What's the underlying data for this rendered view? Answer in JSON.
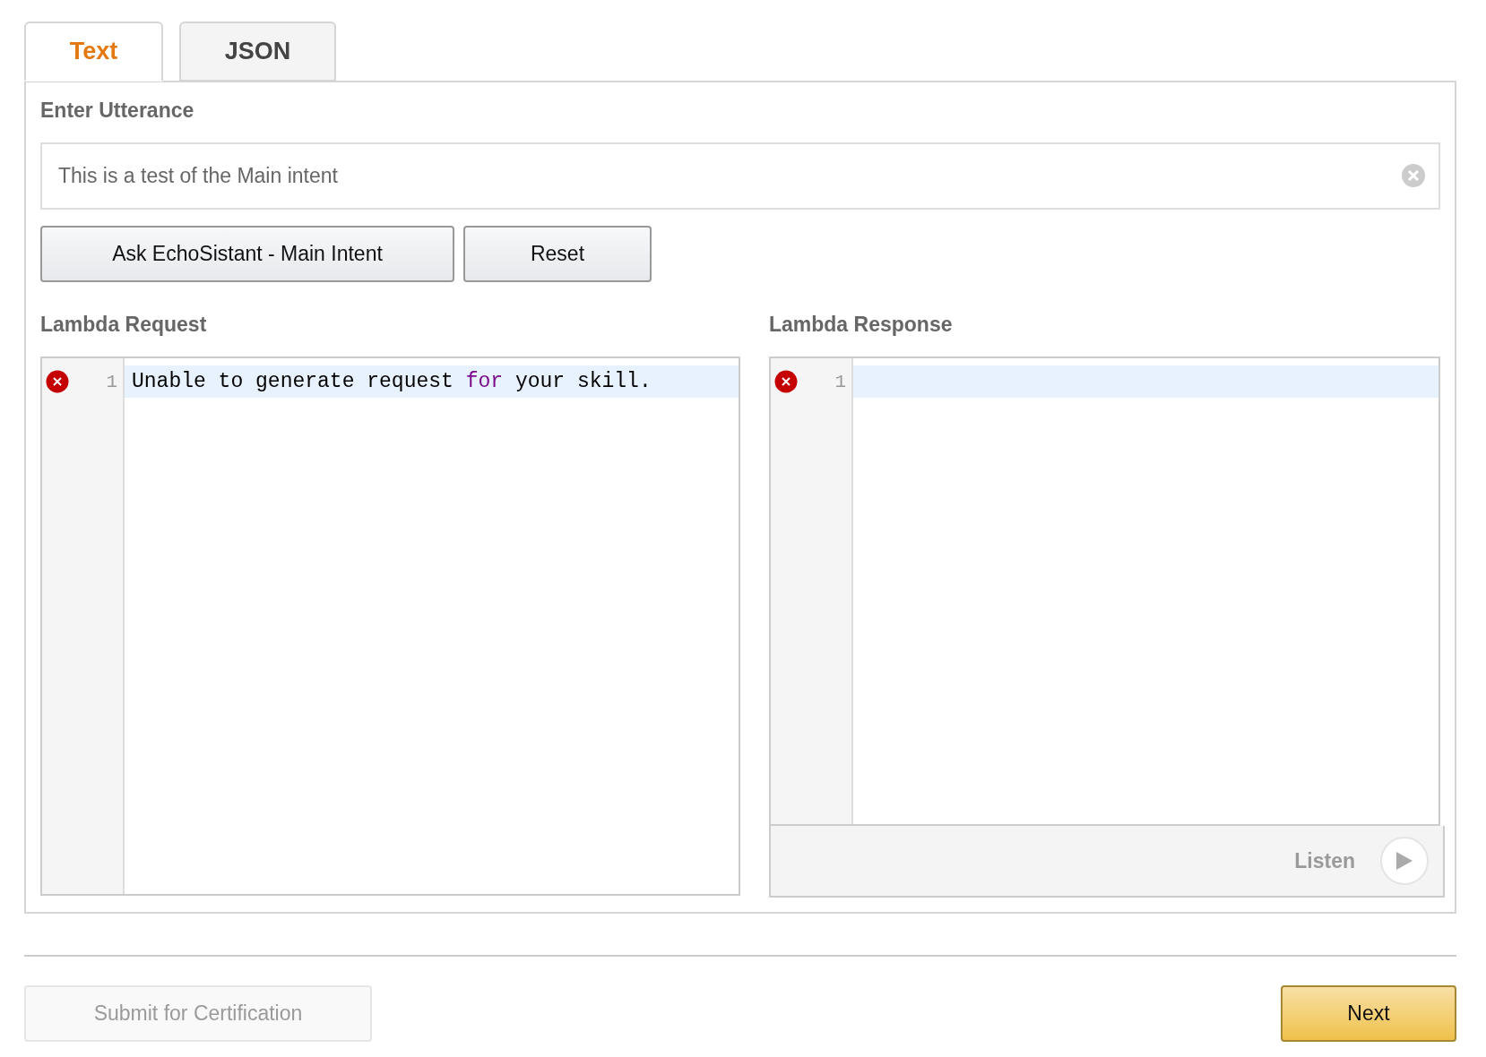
{
  "tabs": [
    {
      "label": "Text",
      "selected": true
    },
    {
      "label": "JSON",
      "selected": false
    }
  ],
  "utterance": {
    "label": "Enter Utterance",
    "value": "This is a test of the Main intent"
  },
  "actions": [
    {
      "label": "Ask EchoSistant - Main Intent"
    },
    {
      "label": "Reset"
    }
  ],
  "request": {
    "title": "Lambda Request",
    "lines": [
      {
        "number": "1",
        "error": true,
        "active": true,
        "tokens": [
          {
            "text": "Unable to generate request ",
            "kind": "plain"
          },
          {
            "text": "for",
            "kind": "keyword"
          },
          {
            "text": " your skill.",
            "kind": "plain"
          }
        ]
      }
    ]
  },
  "response": {
    "title": "Lambda Response",
    "lines": [
      {
        "number": "1",
        "error": true,
        "active": true
      }
    ],
    "listen": {
      "label": "Listen",
      "disabled": true
    }
  },
  "footer": {
    "submit": {
      "label": "Submit for Certification",
      "disabled": true
    },
    "next": {
      "label": "Next",
      "disabled": false
    }
  }
}
